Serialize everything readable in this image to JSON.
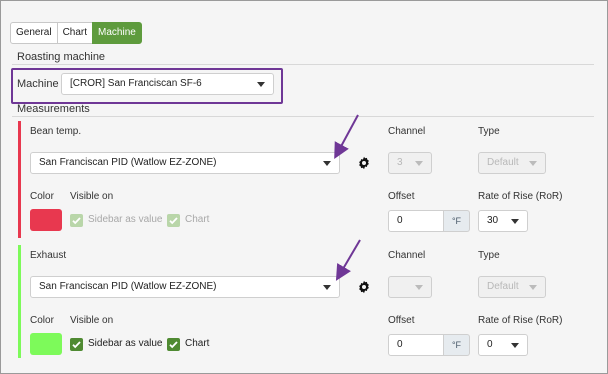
{
  "tabs": [
    {
      "label": "General"
    },
    {
      "label": "Chart"
    },
    {
      "label": "Machine"
    }
  ],
  "roasting": {
    "title": "Roasting machine",
    "machine_label": "Machine",
    "machine_value": "[CROR] San Franciscan SF-6"
  },
  "measurements": {
    "title": "Measurements",
    "channel_header": "Channel",
    "type_header": "Type",
    "offset_header": "Offset",
    "ror_header": "Rate of Rise (RoR)",
    "color_label": "Color",
    "visible_on_label": "Visible on",
    "sidebar_label": "Sidebar as value",
    "chart_label": "Chart",
    "items": [
      {
        "name": "Bean temp.",
        "source": "San Franciscan PID (Watlow EZ-ZONE)",
        "channel": "3",
        "type": "Default",
        "offset": "0",
        "unit": "°F",
        "ror": "30",
        "color": "#e8384f",
        "sidebar_checked": true,
        "chart_checked": true,
        "checks_disabled": true
      },
      {
        "name": "Exhaust",
        "source": "San Franciscan PID (Watlow EZ-ZONE)",
        "channel": "",
        "type": "Default",
        "offset": "0",
        "unit": "°F",
        "ror": "0",
        "color": "#7dfa5a",
        "sidebar_checked": true,
        "chart_checked": true,
        "checks_disabled": false
      }
    ]
  },
  "annotation": {
    "arrow_color": "#6f3796"
  }
}
